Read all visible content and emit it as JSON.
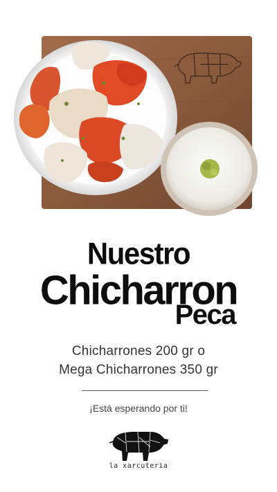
{
  "title": {
    "line1": "Nuestro",
    "line2": "Chicharron",
    "line3": "Peca"
  },
  "description": {
    "line1": "Chicharrones 200 gr o",
    "line2": "Mega Chicharrones 350 gr"
  },
  "tagline": "¡Está esperando por ti!",
  "brand": {
    "name": "la xarcuteria",
    "logo_icon": "pig-icon"
  },
  "colors": {
    "text": "#0d0d0d",
    "board": "#8a5a3c",
    "background": "#ffffff"
  }
}
